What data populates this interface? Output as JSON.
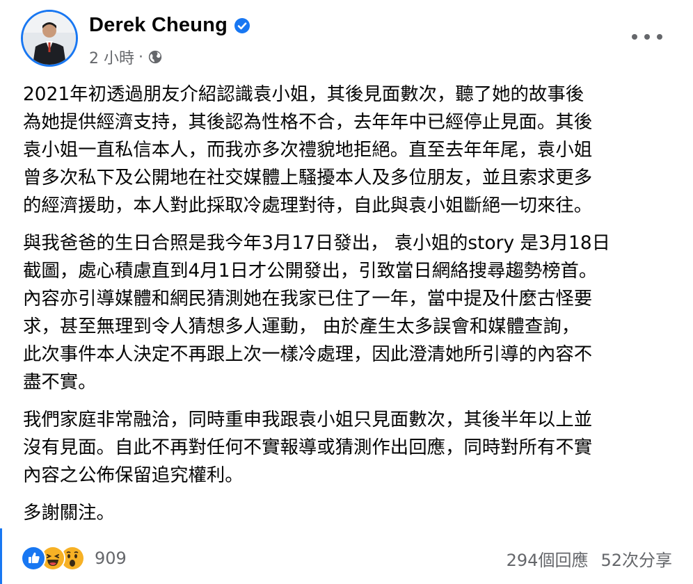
{
  "post": {
    "author": "Derek Cheung",
    "time": "2 小時",
    "separator": "·",
    "audience_icon": "globe-icon",
    "paragraphs": [
      "2021年初透過朋友介紹認識袁小姐，其後見面數次，聽了她的故事後\n為她提供經濟支持，其後認為性格不合，去年年中已經停止見面。其後\n袁小姐一直私信本人，而我亦多次禮貌地拒絕。直至去年年尾，袁小姐\n曾多次私下及公開地在社交媒體上騷擾本人及多位朋友，並且索求更多\n的經濟援助，本人對此採取冷處理對待，自此與袁小姐斷絕一切來往。",
      "與我爸爸的生日合照是我今年3月17日發出， 袁小姐的story 是3月18日\n截圖，處心積慮直到4月1日才公開發出，引致當日網絡搜尋趨勢榜首。\n內容亦引導媒體和網民猜測她在我家已住了一年，當中提及什麼古怪要\n求，甚至無理到令人猜想多人運動， 由於產生太多誤會和媒體查詢，\n此次事件本人決定不再跟上次一樣冷處理，因此澄清她所引導的內容不\n盡不實。",
      "我們家庭非常融洽，同時重申我跟袁小姐只見面數次，其後半年以上並\n沒有見面。自此不再對任何不實報導或猜測作出回應，同時對所有不實\n內容之公佈保留追究權利。",
      "多謝關注。"
    ]
  },
  "footer": {
    "reactions": [
      "like",
      "haha",
      "wow"
    ],
    "reaction_count": "909",
    "comments": "294個回應",
    "shares": "52次分享"
  },
  "colors": {
    "accent": "#1877f2",
    "secondary_text": "#65676b",
    "primary_text": "#050505",
    "reaction_yellow": "#f7b125"
  }
}
